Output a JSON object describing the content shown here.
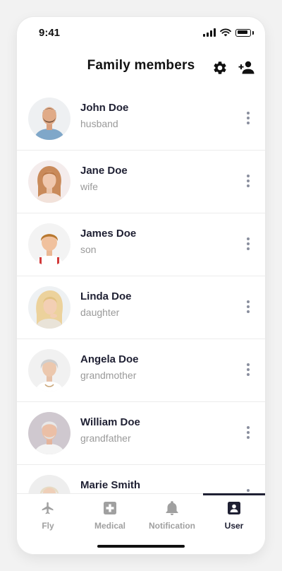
{
  "status_bar": {
    "time": "9:41"
  },
  "header": {
    "title": "Family members",
    "settings_icon": "gear-icon",
    "add_member_icon": "person-add-icon"
  },
  "members": [
    {
      "name": "John Doe",
      "relation": "husband"
    },
    {
      "name": "Jane Doe",
      "relation": "wife"
    },
    {
      "name": "James Doe",
      "relation": "son"
    },
    {
      "name": "Linda Doe",
      "relation": "daughter"
    },
    {
      "name": "Angela Doe",
      "relation": "grandmother"
    },
    {
      "name": "William Doe",
      "relation": "grandfather"
    },
    {
      "name": "Marie Smith",
      "relation": ""
    }
  ],
  "tabs": [
    {
      "label": "Fly",
      "icon": "airplane-icon",
      "active": false
    },
    {
      "label": "Medical",
      "icon": "medical-kit-icon",
      "active": false
    },
    {
      "label": "Notification",
      "icon": "bell-icon",
      "active": false
    },
    {
      "label": "User",
      "icon": "user-badge-icon",
      "active": true
    }
  ],
  "colors": {
    "primary_text": "#1f2033",
    "secondary_text": "#9a9a9a",
    "inactive_tab": "#a0a0a0",
    "divider": "#ececec"
  }
}
